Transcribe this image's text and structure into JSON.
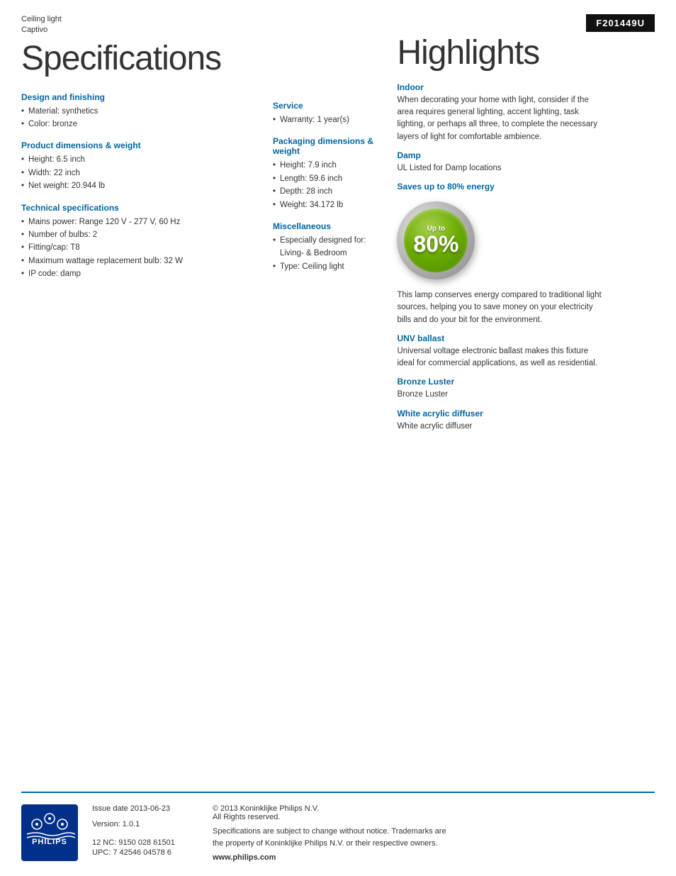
{
  "product": {
    "category": "Ceiling light",
    "subcategory": "Captivo",
    "code": "F201449U"
  },
  "specs_title": "Specifications",
  "highlights_title": "Highlights",
  "design_finishing": {
    "heading": "Design and finishing",
    "items": [
      "Material: synthetics",
      "Color: bronze"
    ]
  },
  "product_dimensions": {
    "heading": "Product dimensions & weight",
    "items": [
      "Height: 6.5 inch",
      "Width: 22 inch",
      "Net weight: 20.944 lb"
    ]
  },
  "technical_specs": {
    "heading": "Technical specifications",
    "items": [
      "Mains power: Range 120 V - 277 V, 60 Hz",
      "Number of bulbs: 2",
      "Fitting/cap: T8",
      "Maximum wattage replacement bulb: 32 W",
      "IP code: damp"
    ]
  },
  "service": {
    "heading": "Service",
    "items": [
      "Warranty: 1 year(s)"
    ]
  },
  "packaging": {
    "heading": "Packaging dimensions & weight",
    "items": [
      "Height: 7.9 inch",
      "Length: 59.6 inch",
      "Depth: 28 inch",
      "Weight: 34.172 lb"
    ]
  },
  "miscellaneous": {
    "heading": "Miscellaneous",
    "items": [
      "Especially designed for: Living- & Bedroom",
      "Type: Ceiling light"
    ]
  },
  "highlights": {
    "indoor": {
      "heading": "Indoor",
      "text": "When decorating your home with light, consider if the area requires general lighting, accent lighting, task lighting, or perhaps all three, to complete the necessary layers of light for comfortable ambience."
    },
    "damp": {
      "heading": "Damp",
      "text": "UL Listed for Damp locations"
    },
    "energy": {
      "heading": "Saves up to 80% energy",
      "badge_up_to": "Up to",
      "badge_percent": "80%",
      "text": "This lamp conserves energy compared to traditional light sources, helping you to save money on your electricity bills and do your bit for the environment."
    },
    "unv_ballast": {
      "heading": "UNV ballast",
      "text": "Universal voltage electronic ballast makes this fixture ideal for commercial applications, as well as residential."
    },
    "bronze_luster": {
      "heading": "Bronze Luster",
      "text": "Bronze Luster"
    },
    "white_diffuser": {
      "heading": "White acrylic diffuser",
      "text": "White acrylic diffuser"
    }
  },
  "footer": {
    "issue_date_label": "Issue date 2013-06-23",
    "version_label": "Version: 1.0.1",
    "nc": "12 NC: 9150 028 61501",
    "upc": "UPC: 7 42546 04578 6",
    "copyright": "© 2013 Koninklijke Philips N.V.",
    "rights": "All Rights reserved.",
    "disclaimer": "Specifications are subject to change without notice. Trademarks are the property of Koninklijke Philips N.V. or their respective owners.",
    "url": "www.philips.com"
  }
}
